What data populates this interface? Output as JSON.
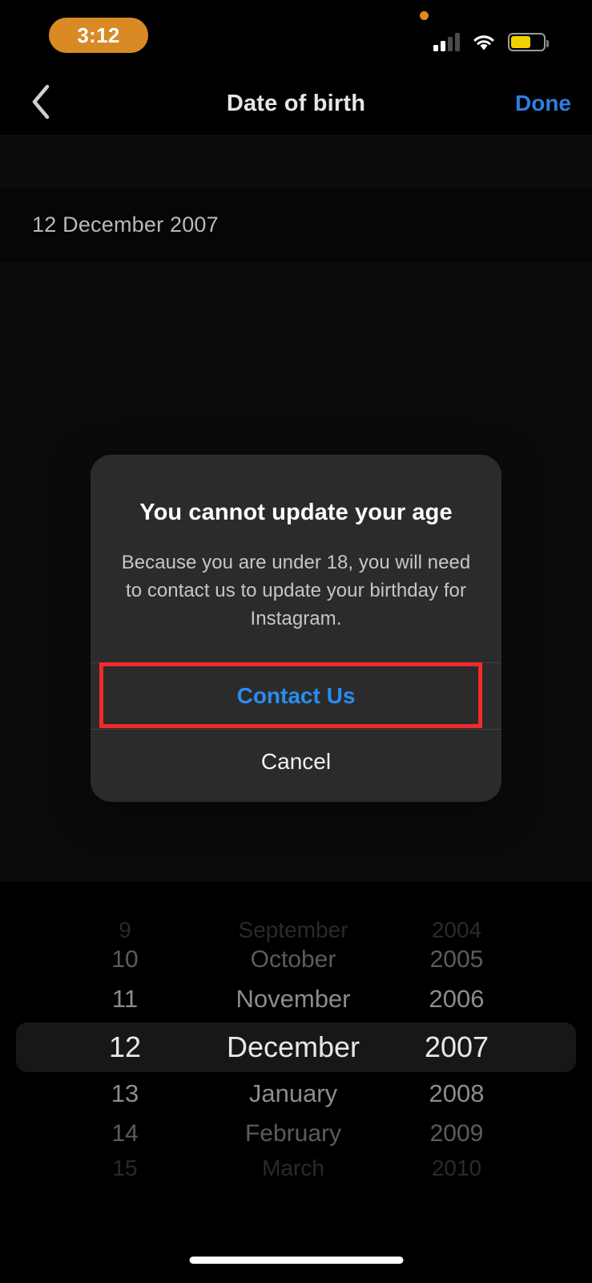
{
  "status_bar": {
    "time": "3:12",
    "time_pill_color": "#D98A25",
    "orange_dot_icon": "orange-privacy-dot",
    "cellular_icon": "cellular-signal-icon",
    "cellular_bars_active": 2,
    "cellular_bars_total": 4,
    "wifi_icon": "wifi-icon",
    "battery_icon": "battery-icon",
    "battery_color": "#F2D100",
    "battery_level_percent": 62
  },
  "nav_bar": {
    "back_icon": "chevron-left-icon",
    "title": "Date of birth",
    "done_label": "Done",
    "done_color": "#2E7EE0"
  },
  "date_row": {
    "value": "12 December 2007"
  },
  "dialog": {
    "title": "You cannot update your age",
    "message": "Because you are under 18, you will need to contact us to update your birthday for Instagram.",
    "primary_button": "Contact Us",
    "primary_button_color": "#2A8CF0",
    "secondary_button": "Cancel",
    "secondary_button_color": "#F2F2F2",
    "background_color": "#2B2B2B"
  },
  "highlight": {
    "color": "#F22A2A",
    "target": "Contact Us"
  },
  "date_picker": {
    "selected_day": "12",
    "selected_month": "December",
    "selected_year": "2007",
    "rows": [
      {
        "day": "9",
        "month": "September",
        "year": "2004",
        "state": "fade2"
      },
      {
        "day": "10",
        "month": "October",
        "year": "2005",
        "state": "fade1"
      },
      {
        "day": "11",
        "month": "November",
        "year": "2006",
        "state": "normal"
      },
      {
        "day": "12",
        "month": "December",
        "year": "2007",
        "state": "selected"
      },
      {
        "day": "13",
        "month": "January",
        "year": "2008",
        "state": "normal"
      },
      {
        "day": "14",
        "month": "February",
        "year": "2009",
        "state": "fade1"
      },
      {
        "day": "15",
        "month": "March",
        "year": "2010",
        "state": "fade2"
      }
    ]
  },
  "home_indicator": {
    "label": "home-indicator"
  }
}
